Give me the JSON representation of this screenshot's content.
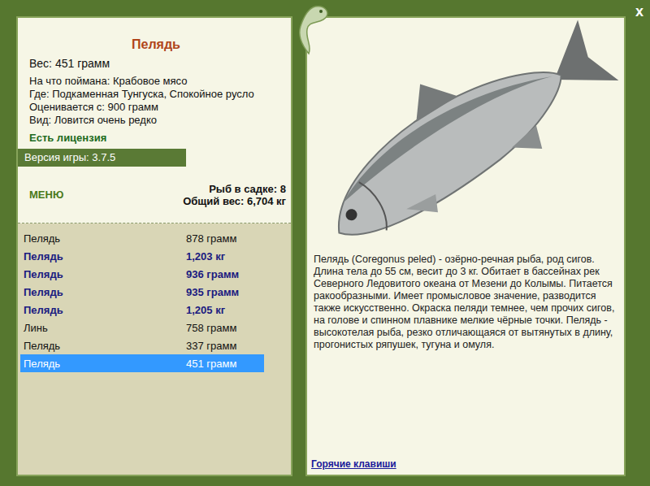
{
  "fish": {
    "title": "Пелядь",
    "weight": "Вес: 451 грамм",
    "details": [
      "На что поймана: Крабовое мясо",
      "Где: Подкаменная Тунгуска, Спокойное русло",
      "Оценивается с: 900 грамм",
      "Вид: Ловится очень редко"
    ],
    "license": "Есть лицензия"
  },
  "version": "Версия игры: 3.7.5",
  "menu_button": "МЕНЮ",
  "keepnet": {
    "count": "Рыб в садке: 8",
    "total": "Общий вес: 6,704 кг"
  },
  "catch_list": [
    {
      "name": "Пелядь",
      "weight": "878 грамм",
      "trophy": false,
      "selected": false
    },
    {
      "name": "Пелядь",
      "weight": "1,203 кг",
      "trophy": true,
      "selected": false
    },
    {
      "name": "Пелядь",
      "weight": "936 грамм",
      "trophy": true,
      "selected": false
    },
    {
      "name": "Пелядь",
      "weight": "935 грамм",
      "trophy": true,
      "selected": false
    },
    {
      "name": "Пелядь",
      "weight": "1,205 кг",
      "trophy": true,
      "selected": false
    },
    {
      "name": "Линь",
      "weight": "758 грамм",
      "trophy": false,
      "selected": false
    },
    {
      "name": "Пелядь",
      "weight": "337 грамм",
      "trophy": false,
      "selected": false
    },
    {
      "name": "Пелядь",
      "weight": "451 грамм",
      "trophy": false,
      "selected": true
    }
  ],
  "description": "Пелядь (Coregonus peled) - озёрно-речная рыба, род сигов. Длина тела до 55 см, весит до 3 кг. Обитает в бассейнах рек Северного Ледовитого океана от Мезени до Колымы. Питается ракообразными. Имеет промысловое значение, разводится также искусственно. Окраска пеляди темнее, чем прочих сигов, на голове и спинном плавнике мелкие чёрные точки. Пелядь - высокотелая рыба, резко отличающаяся от вытянутых в длину, прогонистых ряпушек, тугуна и омуля.",
  "hotkeys_link": "Горячие клавиши",
  "close_button": "x"
}
